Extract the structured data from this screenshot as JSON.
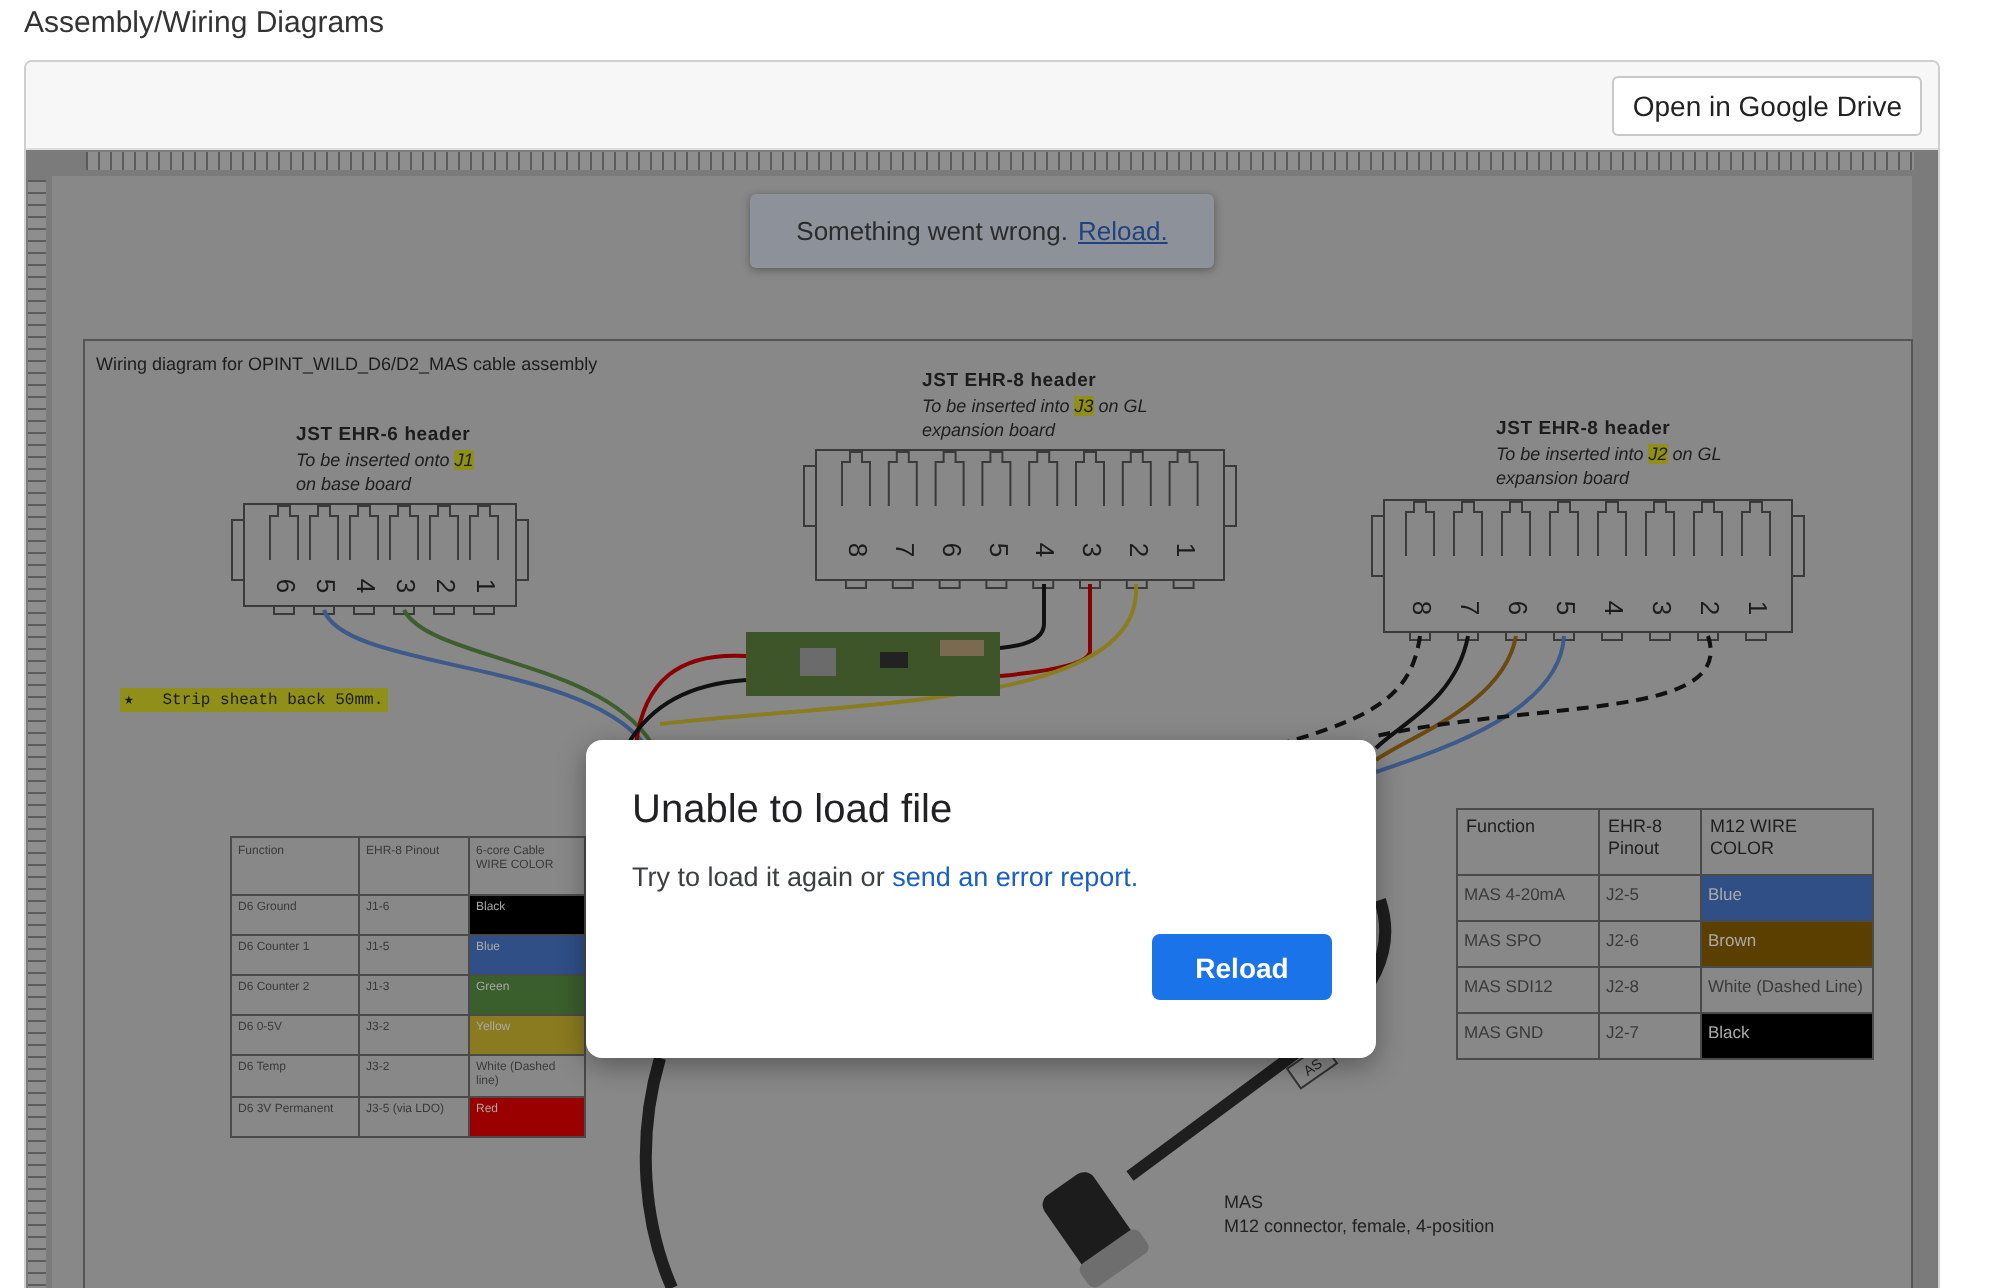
{
  "page_title": "Assembly/Wiring Diagrams",
  "toolbar": {
    "open_button": "Open in Google Drive"
  },
  "error_toast": {
    "message": "Something went wrong.",
    "link": "Reload."
  },
  "document": {
    "title": "Wiring diagram for OPINT_WILD_D6/D2_MAS cable assembly",
    "headers": [
      {
        "title": "JST EHR-6 header",
        "note": "To be inserted onto ",
        "ref": "J1",
        "line2": "on base board",
        "pins": [
          "6",
          "5",
          "4",
          "3",
          "2",
          "1"
        ]
      },
      {
        "title": "JST EHR-8 header",
        "note": "To be inserted into ",
        "ref": "J3",
        "note_after": " on GL",
        "line2": "expansion board",
        "pins": [
          "8",
          "7",
          "6",
          "5",
          "4",
          "3",
          "2",
          "1"
        ]
      },
      {
        "title": "JST EHR-8 header",
        "note": "To be inserted into ",
        "ref": "J2",
        "note_after": " on GL",
        "line2": "expansion board",
        "pins": [
          "8",
          "7",
          "6",
          "5",
          "4",
          "3",
          "2",
          "1"
        ]
      }
    ],
    "strip_note": "★   Strip sheath back 50mm.",
    "tables": [
      {
        "columns": [
          "Function",
          "EHR-8 Pinout",
          "6-core Cable WIRE COLOR"
        ],
        "rows": [
          {
            "cells": [
              "D6 Ground",
              "J1-6",
              "Black"
            ],
            "color": "#000000"
          },
          {
            "cells": [
              "D6 Counter 1",
              "J1-5",
              "Blue"
            ],
            "color": "#2f4f86"
          },
          {
            "cells": [
              "D6 Counter 2",
              "J1-3",
              "Green"
            ],
            "color": "#3b5e2d"
          },
          {
            "cells": [
              "D6 0-5V",
              "J3-2",
              "Yellow"
            ],
            "color": "#8a7a20"
          },
          {
            "cells": [
              "D6 Temp",
              "J3-2",
              "White (Dashed line)"
            ]
          },
          {
            "cells": [
              "D6 3V Permanent",
              "J3-5 (via LDO)",
              "Red"
            ],
            "color": "#9a0000"
          }
        ]
      },
      {
        "columns": [
          "Function",
          "EHR-8 Pinout",
          "M12 WIRE COLOR"
        ],
        "rows": [
          {
            "cells": [
              "MAS 4-20mA",
              "J2-5",
              "Blue"
            ],
            "color": "#2f4f86"
          },
          {
            "cells": [
              "MAS SPO",
              "J2-6",
              "Brown"
            ],
            "color": "#5a3f00"
          },
          {
            "cells": [
              "MAS SDI12",
              "J2-8",
              "White (Dashed Line)"
            ]
          },
          {
            "cells": [
              "MAS GND",
              "J2-7",
              "Black"
            ],
            "color": "#000000"
          }
        ]
      }
    ],
    "cable_tag": "AS",
    "connector_caption": {
      "line1": "MAS",
      "line2": "M12 connector, female, 4-position"
    }
  },
  "dialog": {
    "title": "Unable to load file",
    "text": "Try to load it again or ",
    "link": "send an error report.",
    "button": "Reload"
  }
}
